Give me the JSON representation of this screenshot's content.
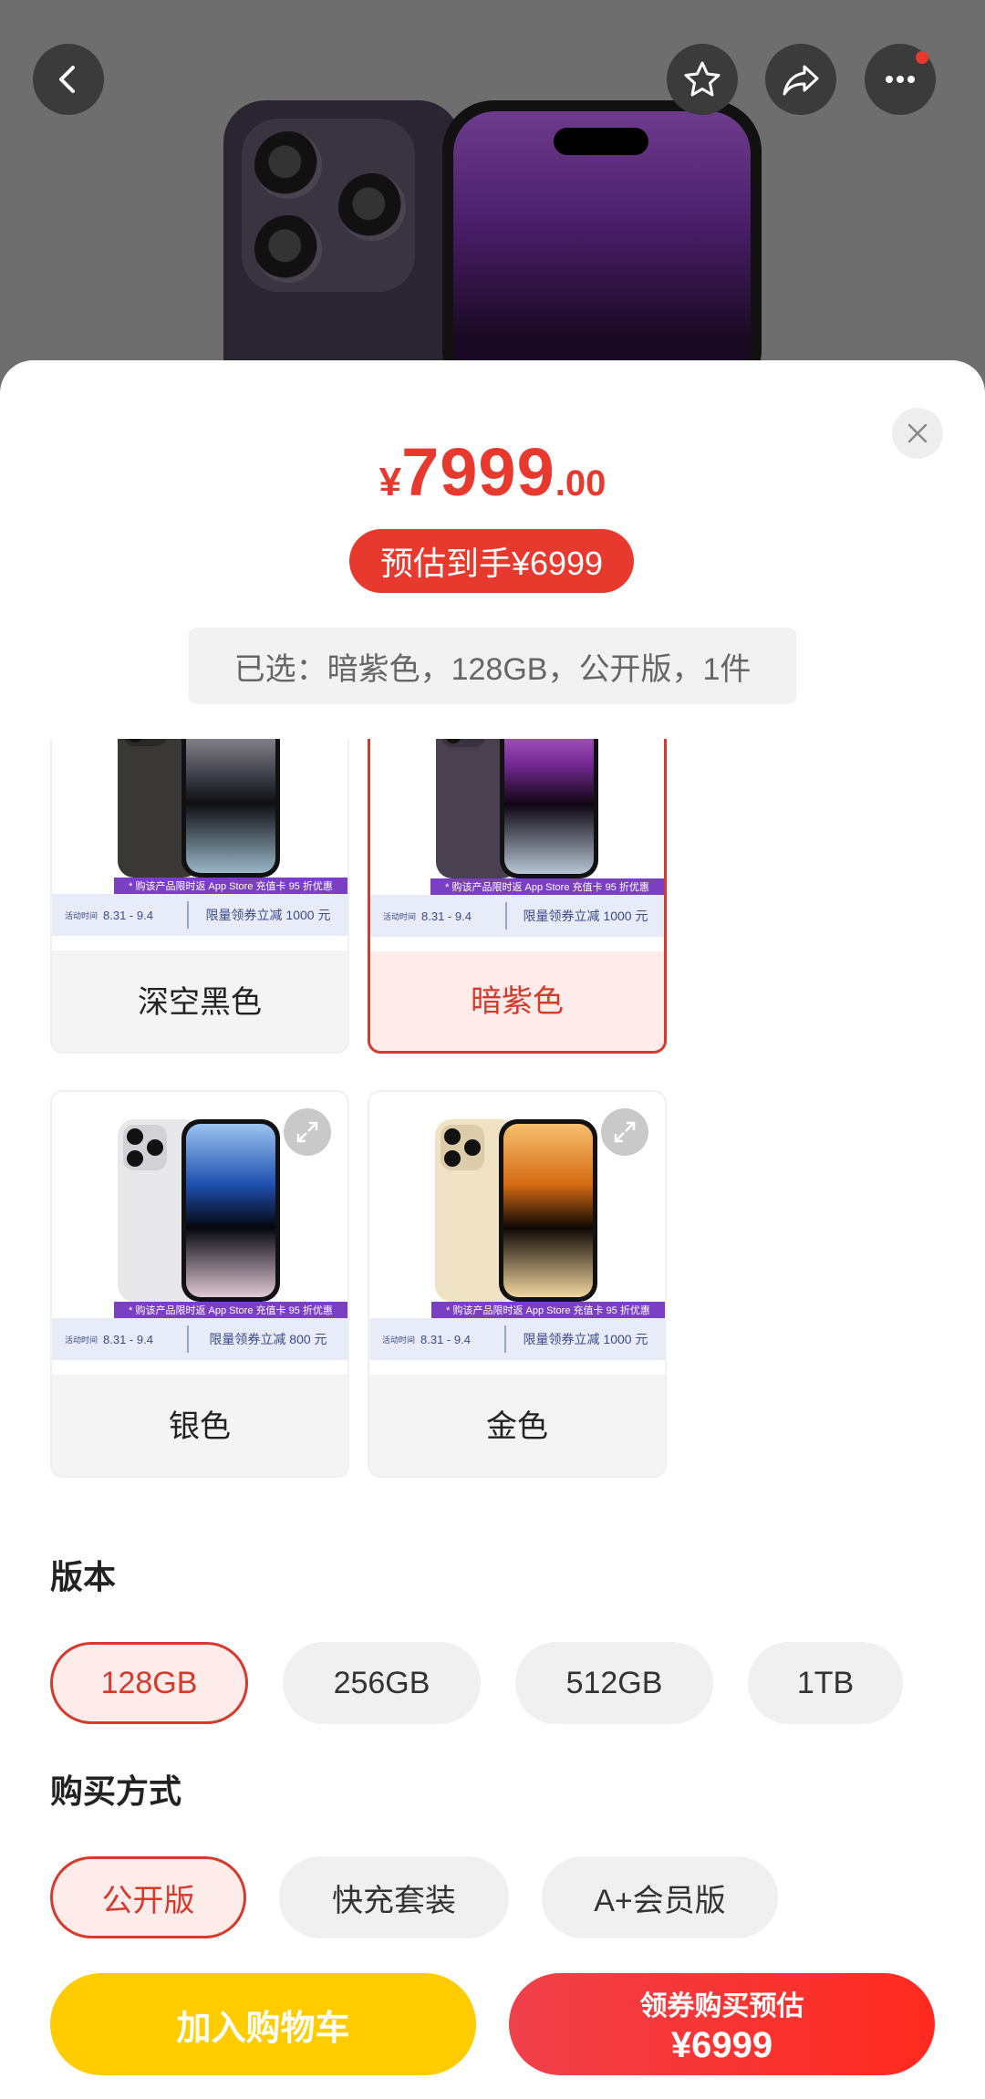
{
  "price": {
    "currency": "¥",
    "integer": "7999",
    "decimal": ".00"
  },
  "estimate": {
    "label": "预估到手¥6999"
  },
  "selected_summary": "已选：暗紫色，128GB，公开版，1件",
  "colors": [
    {
      "name": "深空黑色",
      "promo_top": "* 购该产品限时返 App Store 充值卡 95 折优惠",
      "promo_tag": "活动时间",
      "promo_dates": "8.31 - 9.4",
      "promo_coupon": "限量领券立减 1000 元",
      "selected": false
    },
    {
      "name": "暗紫色",
      "promo_top": "* 购该产品限时返 App Store 充值卡 95 折优惠",
      "promo_tag": "活动时间",
      "promo_dates": "8.31 - 9.4",
      "promo_coupon": "限量领券立减 1000 元",
      "selected": true
    },
    {
      "name": "银色",
      "promo_top": "* 购该产品限时返 App Store 充值卡 95 折优惠",
      "promo_tag": "活动时间",
      "promo_dates": "8.31 - 9.4",
      "promo_coupon": "限量领券立减 800 元",
      "selected": false
    },
    {
      "name": "金色",
      "promo_top": "* 购该产品限时返 App Store 充值卡 95 折优惠",
      "promo_tag": "活动时间",
      "promo_dates": "8.31 - 9.4",
      "promo_coupon": "限量领券立减 1000 元",
      "selected": false
    }
  ],
  "version": {
    "title": "版本",
    "options": [
      "128GB",
      "256GB",
      "512GB",
      "1TB"
    ],
    "selected": "128GB"
  },
  "purchase": {
    "title": "购买方式",
    "options": [
      "公开版",
      "快充套装",
      "A+会员版"
    ],
    "selected": "公开版"
  },
  "actions": {
    "cart": "加入购物车",
    "buy_line1": "领券购买预估",
    "buy_line2": "¥6999"
  },
  "icons": {
    "back": "back-arrow-icon",
    "favorite": "star-icon",
    "share": "share-icon",
    "more": "more-icon",
    "close": "close-icon",
    "expand": "expand-icon"
  },
  "theme": {
    "accent": "#e8392f",
    "cart": "#ffcc00"
  }
}
